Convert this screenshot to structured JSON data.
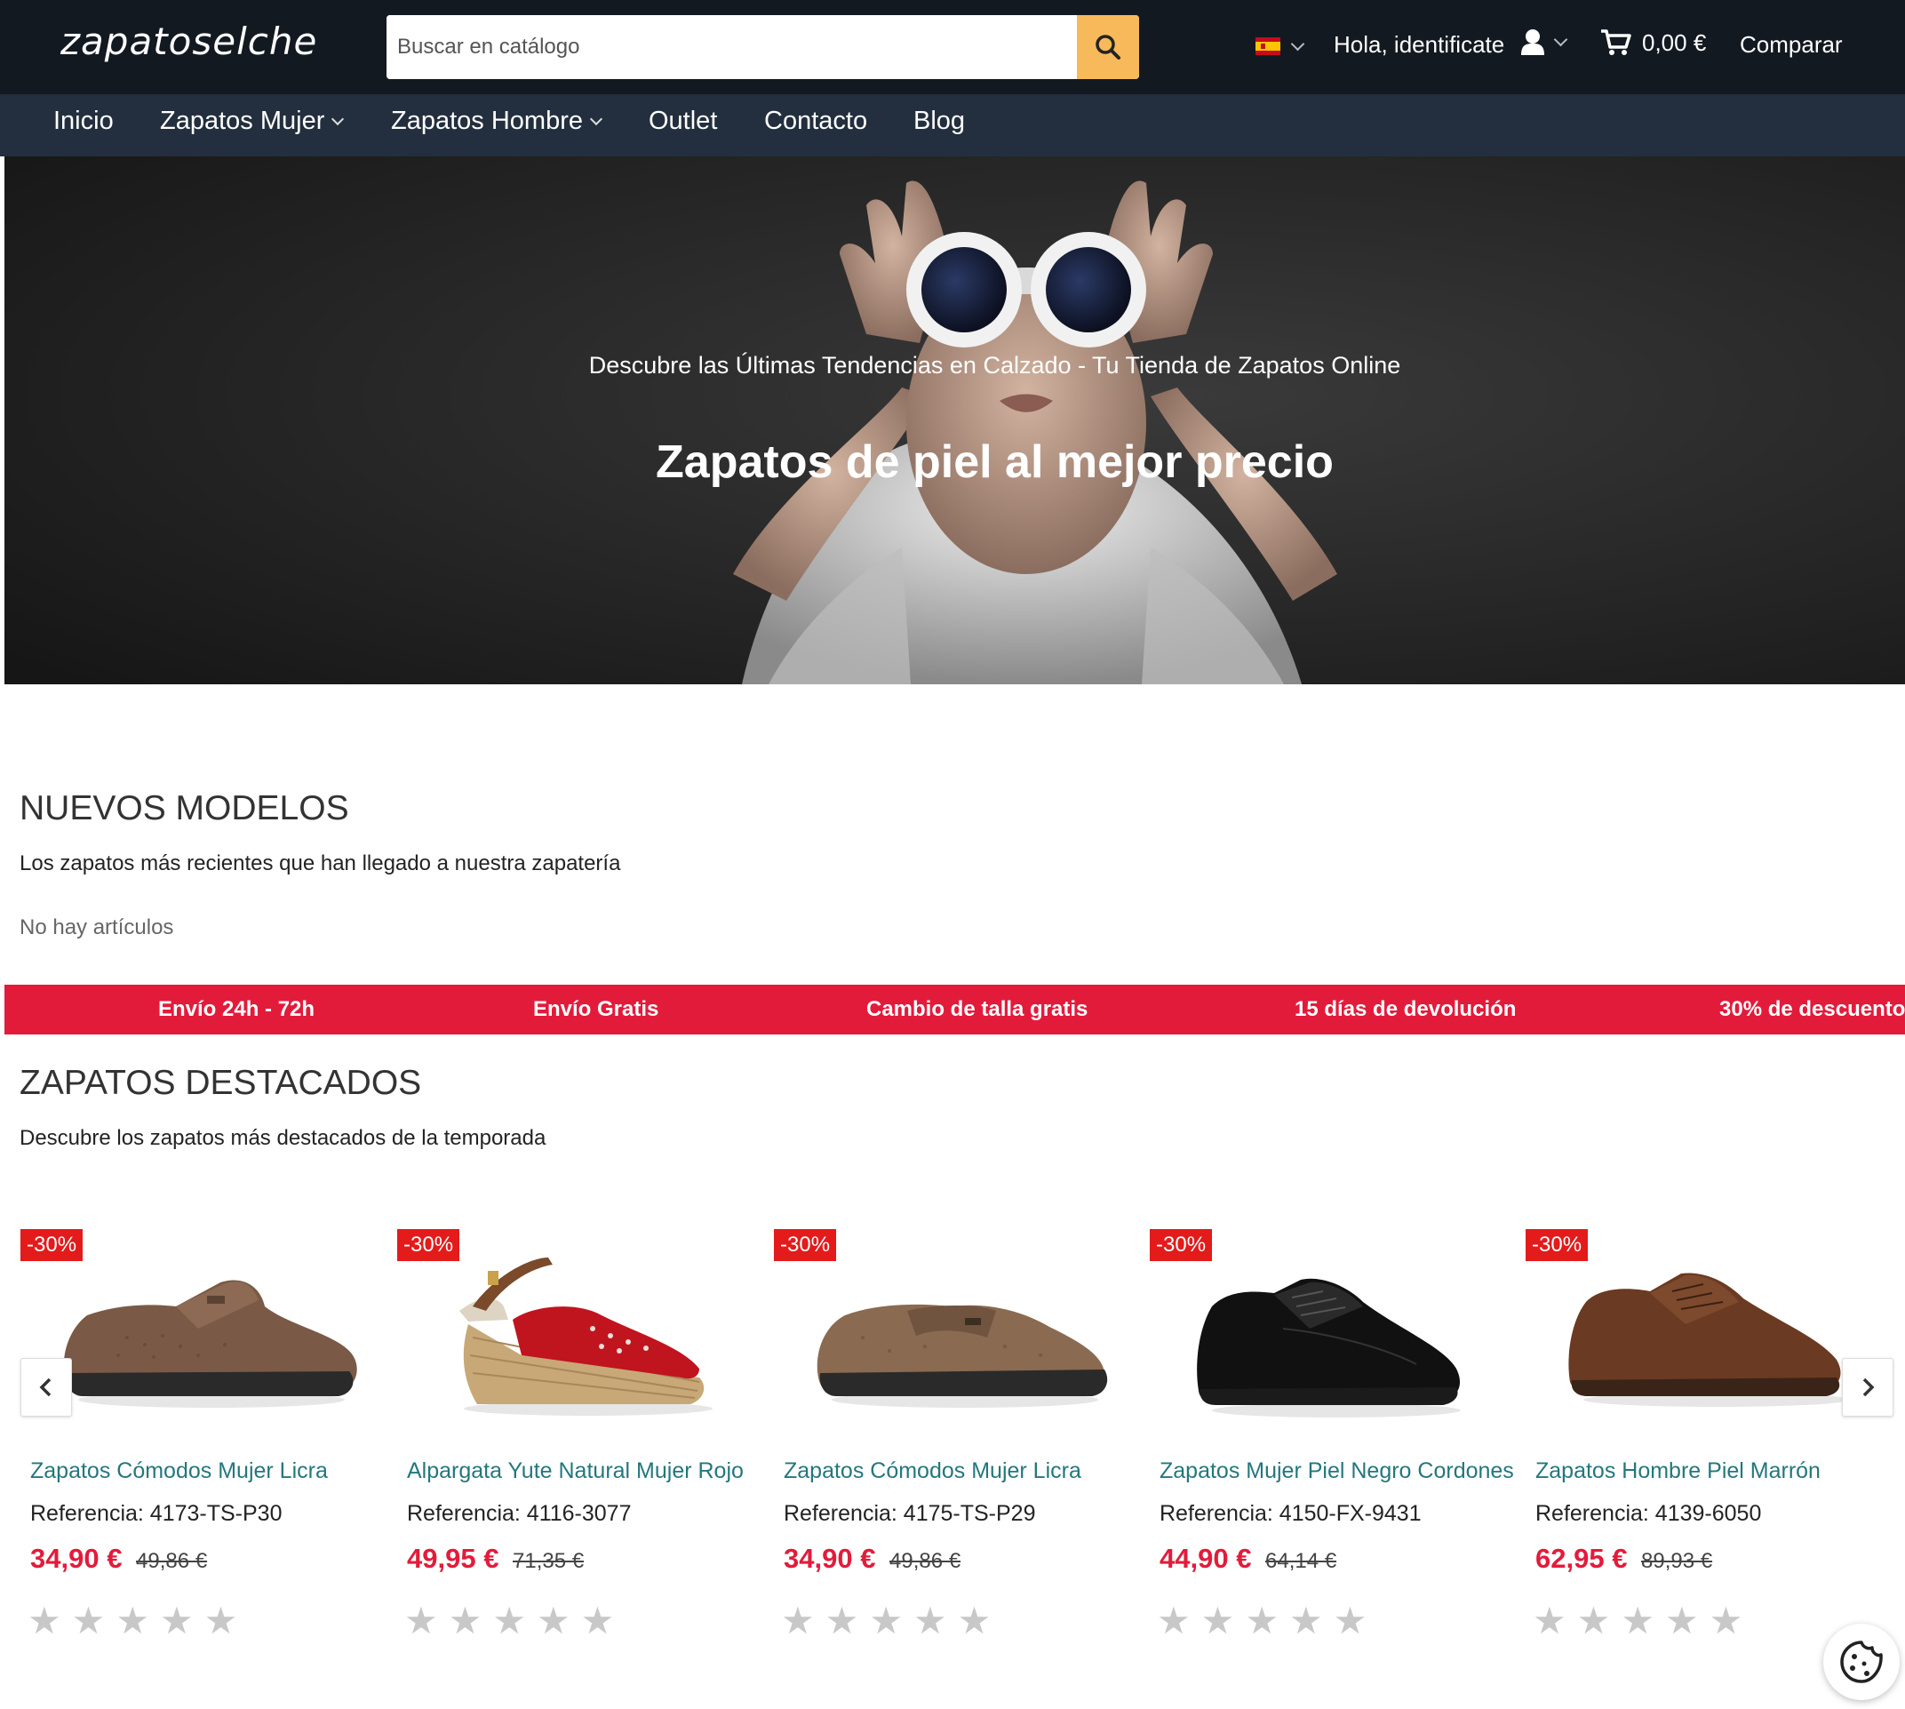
{
  "header": {
    "logo": "zapatoselche",
    "search": {
      "placeholder": "Buscar en catálogo",
      "value": ""
    },
    "language": "es",
    "greeting": "Hola, identificate",
    "cart_total": "0,00 €",
    "compare": "Comparar"
  },
  "nav": {
    "items": [
      {
        "label": "Inicio",
        "has_dropdown": false
      },
      {
        "label": "Zapatos Mujer",
        "has_dropdown": true
      },
      {
        "label": "Zapatos Hombre",
        "has_dropdown": true
      },
      {
        "label": "Outlet",
        "has_dropdown": false
      },
      {
        "label": "Contacto",
        "has_dropdown": false
      },
      {
        "label": "Blog",
        "has_dropdown": false
      }
    ]
  },
  "hero": {
    "subtitle": "Descubre las Últimas Tendencias en Calzado - Tu Tienda de Zapatos Online",
    "title": "Zapatos de piel al mejor precio"
  },
  "new_models": {
    "title": "NUEVOS MODELOS",
    "subtitle": "Los zapatos más recientes que han llegado a nuestra zapatería",
    "empty_text": "No hay artículos"
  },
  "benefits": [
    "Envío 24h - 72h",
    "Envío Gratis",
    "Cambio de talla gratis",
    "15 días de devolución",
    "30% de descuento"
  ],
  "featured": {
    "title": "ZAPATOS DESTACADOS",
    "subtitle": "Descubre los zapatos más destacados de la temporada",
    "products": [
      {
        "badge": "-30%",
        "name": "Zapatos Cómodos Mujer Licra",
        "reference": "Referencia: 4173-TS-P30",
        "price": "34,90 €",
        "old_price": "49,86 €",
        "rating": 0,
        "image": "brown-velcro-shoe"
      },
      {
        "badge": "-30%",
        "name": "Alpargata Yute Natural Mujer Rojo",
        "reference": "Referencia: 4116-3077",
        "price": "49,95 €",
        "old_price": "71,35 €",
        "rating": 0,
        "image": "red-espadrille-wedge"
      },
      {
        "badge": "-30%",
        "name": "Zapatos Cómodos Mujer Licra",
        "reference": "Referencia: 4175-TS-P29",
        "price": "34,90 €",
        "old_price": "49,86 €",
        "rating": 0,
        "image": "brown-slip-on-shoe"
      },
      {
        "badge": "-30%",
        "name": "Zapatos Mujer Piel Negro Cordones",
        "reference": "Referencia: 4150-FX-9431",
        "price": "44,90 €",
        "old_price": "64,14 €",
        "rating": 0,
        "image": "black-lace-up-shoe"
      },
      {
        "badge": "-30%",
        "name": "Zapatos Hombre Piel Marrón",
        "reference": "Referencia: 4139-6050",
        "price": "62,95 €",
        "old_price": "89,93 €",
        "rating": 0,
        "image": "brown-derby-shoe"
      }
    ]
  },
  "colors": {
    "header_bg": "#131921",
    "nav_bg": "#232f3e",
    "search_button": "#f7b95a",
    "accent_red": "#e31b3b",
    "product_link": "#24777e"
  },
  "icons": {
    "search": "search-icon",
    "user": "user-icon",
    "cart": "cart-icon",
    "prev": "chevron-left-icon",
    "next": "chevron-right-icon",
    "cookie": "cookie-icon"
  }
}
